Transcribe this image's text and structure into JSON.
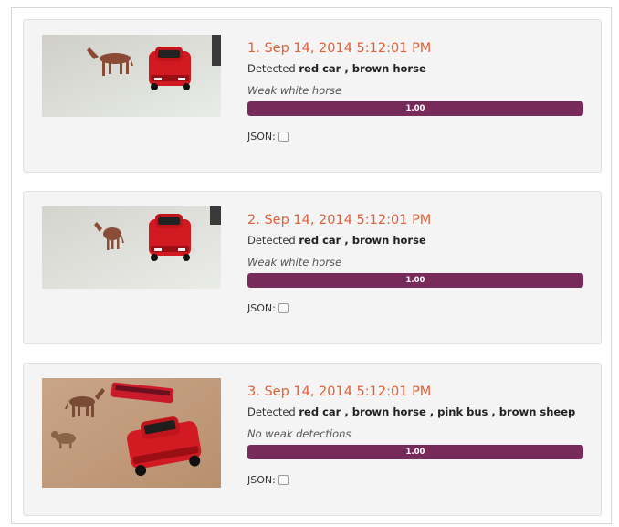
{
  "detected_prefix": "Detected",
  "json_label": "JSON:",
  "colors": {
    "title": "#e0603a",
    "bar": "#772b5a",
    "card_bg": "#f4f4f4"
  },
  "results": [
    {
      "title": "1. Sep 14, 2014 5:12:01 PM",
      "detections": "red car , brown horse",
      "weak": "Weak white horse",
      "confidence_label": "1.00",
      "confidence": 1.0,
      "json_checked": false
    },
    {
      "title": "2. Sep 14, 2014 5:12:01 PM",
      "detections": "red car , brown horse",
      "weak": "Weak white horse",
      "confidence_label": "1.00",
      "confidence": 1.0,
      "json_checked": false
    },
    {
      "title": "3. Sep 14, 2014 5:12:01 PM",
      "detections": "red car , brown horse , pink bus , brown sheep",
      "weak": "No weak detections",
      "confidence_label": "1.00",
      "confidence": 1.0,
      "json_checked": false
    }
  ]
}
